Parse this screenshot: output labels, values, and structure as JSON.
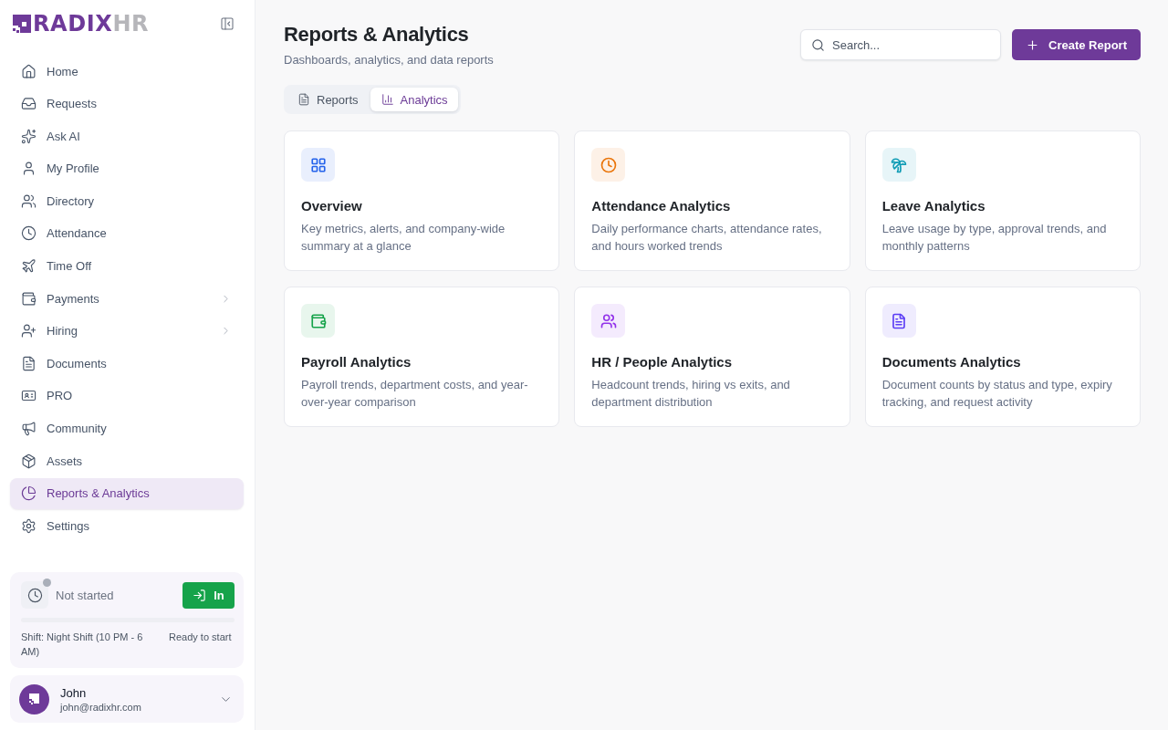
{
  "logo": {
    "brand": "RADIX",
    "accent": "HR"
  },
  "sidebar": {
    "items": [
      {
        "label": "Home",
        "kind": "link",
        "selected": false
      },
      {
        "label": "Requests",
        "kind": "link",
        "selected": false
      },
      {
        "label": "Ask AI",
        "kind": "link",
        "selected": false
      },
      {
        "label": "My Profile",
        "kind": "link",
        "selected": false
      },
      {
        "label": "Directory",
        "kind": "link",
        "selected": false
      },
      {
        "label": "Attendance",
        "kind": "link",
        "selected": false
      },
      {
        "label": "Time Off",
        "kind": "link",
        "selected": false
      },
      {
        "label": "Payments",
        "kind": "submenu",
        "selected": false
      },
      {
        "label": "Hiring",
        "kind": "submenu",
        "selected": false
      },
      {
        "label": "Documents",
        "kind": "link",
        "selected": false
      },
      {
        "label": "PRO",
        "kind": "link",
        "selected": false
      },
      {
        "label": "Community",
        "kind": "link",
        "selected": false
      },
      {
        "label": "Assets",
        "kind": "link",
        "selected": false
      },
      {
        "label": "Reports & Analytics",
        "kind": "link",
        "selected": true
      },
      {
        "label": "Settings",
        "kind": "link",
        "selected": false
      }
    ]
  },
  "clock_widget": {
    "status": "Not started",
    "color": "#a9afb9",
    "button": "In",
    "progress": {
      "level": 0
    },
    "shift": "Shift: Night Shift (10 PM - 6 AM)",
    "note": "Ready to start"
  },
  "user": {
    "name": "John",
    "email": "john@radixhr.com"
  },
  "page": {
    "title": "Reports & Analytics",
    "subtitle": "Dashboards, analytics, and data reports"
  },
  "search": {
    "placeholder": "Search..."
  },
  "create_button": "Create Report",
  "tabs": [
    {
      "label": "Reports",
      "selected": false
    },
    {
      "label": "Analytics",
      "selected": true
    }
  ],
  "cards": [
    {
      "title": "Overview",
      "description": "Key metrics, alerts, and company-wide summary at a glance",
      "color": "#2563eb"
    },
    {
      "title": "Attendance Analytics",
      "description": "Daily performance charts, attendance rates, and hours worked trends",
      "color": "#ea760c"
    },
    {
      "title": "Leave Analytics",
      "description": "Leave usage by type, approval trends, and monthly patterns",
      "color": "#0e9bb4"
    },
    {
      "title": "Payroll Analytics",
      "description": "Payroll trends, department costs, and year-over-year comparison",
      "color": "#16a34a"
    },
    {
      "title": "HR / People Analytics",
      "description": "Headcount trends, hiring vs exits, and department distribution",
      "color": "#9333ea"
    },
    {
      "title": "Documents Analytics",
      "description": "Document counts by status and type, expiry tracking, and request activity",
      "color": "#5b3df5"
    }
  ]
}
